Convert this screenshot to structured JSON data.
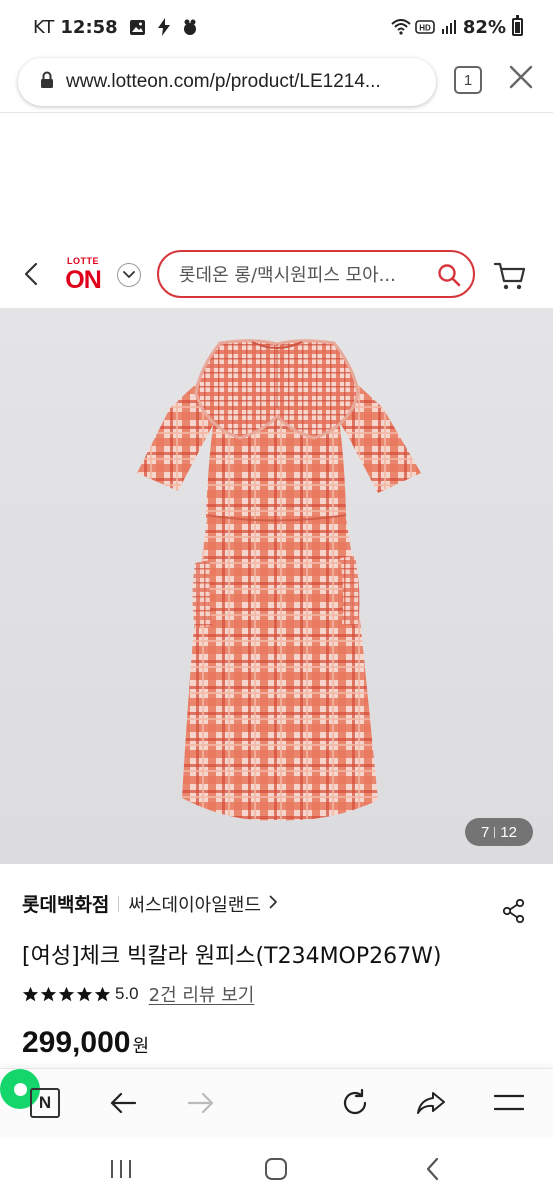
{
  "status_bar": {
    "carrier": "KT",
    "time": "12:58",
    "battery": "82%",
    "icons": [
      "gallery-icon",
      "flash-icon",
      "bixby-icon",
      "wifi-icon",
      "hd-icon",
      "signal-icon",
      "battery-icon"
    ]
  },
  "browser": {
    "url": "www.lotteon.com/p/product/LE1214...",
    "tab_count": "1"
  },
  "header": {
    "logo_top": "LOTTE",
    "logo_bottom": "ON",
    "search_placeholder": "롯데온 롱/맥시원피스 모아...",
    "accent_color": "#d6353c"
  },
  "gallery": {
    "current": "7",
    "total": "12"
  },
  "product": {
    "brand": "롯데백화점",
    "shop": "써스데이아일랜드",
    "title": "[여성]체크 빅칼라 원피스(T234MOP267W)",
    "rating_stars": 5,
    "rating_value": "5.0",
    "review_link": "2건 리뷰 보기",
    "price": "299,000",
    "price_unit": "원"
  },
  "toolbar": {
    "n_label": "N"
  }
}
